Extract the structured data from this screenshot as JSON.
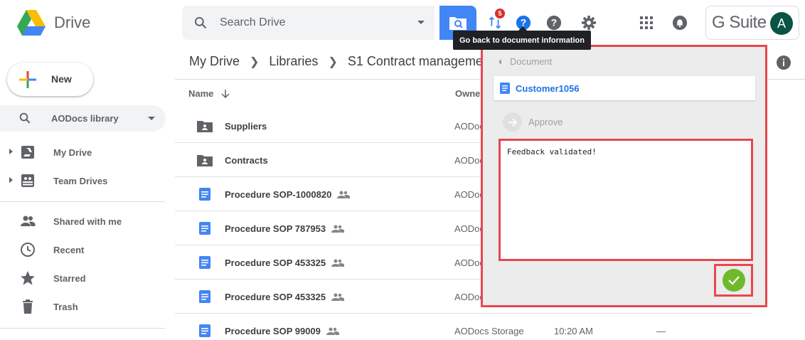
{
  "app": {
    "title": "Drive"
  },
  "search": {
    "placeholder": "Search Drive"
  },
  "header": {
    "notification_count": "5",
    "tooltip": "Go back to document information",
    "gsuite_label": "G Suite",
    "avatar_initial": "A"
  },
  "sidebar": {
    "new_label": "New",
    "library_label": "AODocs library",
    "items": [
      {
        "label": "My Drive"
      },
      {
        "label": "Team Drives"
      },
      {
        "label": "Shared with me"
      },
      {
        "label": "Recent"
      },
      {
        "label": "Starred"
      },
      {
        "label": "Trash"
      }
    ]
  },
  "breadcrumb": {
    "items": [
      "My Drive",
      "Libraries",
      "S1 Contract manageme"
    ]
  },
  "table": {
    "columns": {
      "name": "Name",
      "owner": "Owner"
    },
    "rows": [
      {
        "name": "Suppliers",
        "owner": "AODoc",
        "type": "folder"
      },
      {
        "name": "Contracts",
        "owner": "AODoc",
        "type": "folder"
      },
      {
        "name": "Procedure SOP-1000820",
        "owner": "AODoc",
        "type": "doc"
      },
      {
        "name": "Procedure SOP 787953",
        "owner": "AODoc",
        "type": "doc"
      },
      {
        "name": "Procedure SOP 453325",
        "owner": "AODoc",
        "type": "doc"
      },
      {
        "name": "Procedure SOP 453325",
        "owner": "AODoc",
        "type": "doc"
      },
      {
        "name": "Procedure SOP 99009",
        "owner": "AODocs Storage",
        "time": "10:20 AM",
        "size": "—",
        "type": "doc"
      }
    ]
  },
  "panel": {
    "back_label": "Document",
    "document_name": "Customer1056",
    "action_label": "Approve",
    "feedback_text": "Feedback validated!"
  },
  "colors": {
    "accent": "#4285f4",
    "highlight": "#e8474e",
    "confirm": "#6fba2c",
    "doc_blue": "#4285f4"
  }
}
